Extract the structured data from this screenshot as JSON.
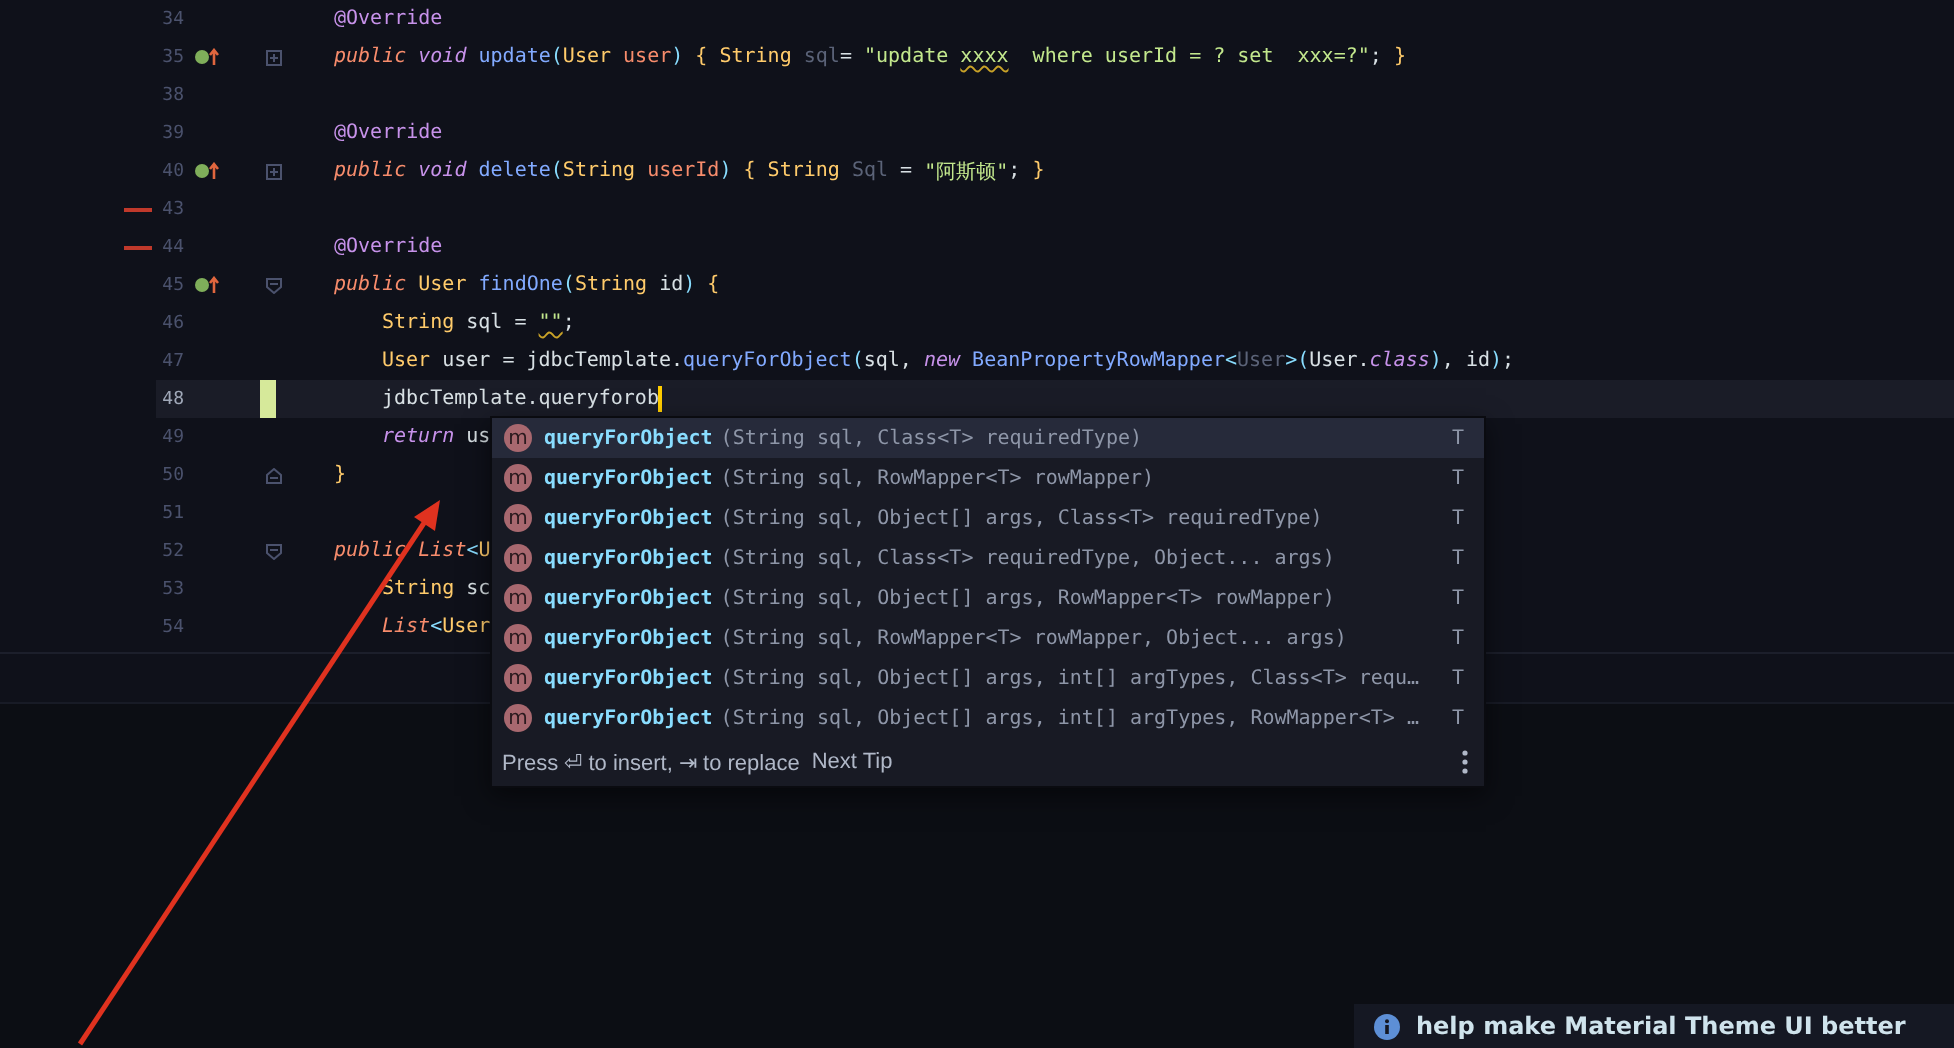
{
  "editor": {
    "lines": [
      {
        "number": "34",
        "kind": "member",
        "tokens": [
          {
            "kind": "ann",
            "text": "@Override"
          }
        ]
      },
      {
        "number": "35",
        "kind": "member",
        "override": true,
        "fold": {
          "kind": "collapsed"
        },
        "tokens": [
          {
            "kind": "mod",
            "text": "public"
          },
          {
            "kind": "kw",
            "text": " void"
          },
          {
            "kind": "fn",
            "text": " update"
          },
          {
            "kind": "punct",
            "text": "("
          },
          {
            "kind": "type",
            "text": "User"
          },
          {
            "kind": "param",
            "text": " user"
          },
          {
            "kind": "punct",
            "text": ")"
          },
          {
            "kind": "brace",
            "text": " {"
          },
          {
            "kind": "type",
            "text": " String"
          },
          {
            "kind": "dim",
            "text": " sql"
          },
          {
            "kind": "plain",
            "text": "= "
          },
          {
            "kind": "str",
            "text": "\"update "
          },
          {
            "kind": "warn",
            "text": "xxxx"
          },
          {
            "kind": "str",
            "text": "  where userId = ? set  xxx=?\""
          },
          {
            "kind": "plain",
            "text": ";"
          },
          {
            "kind": "brace",
            "text": " }"
          }
        ]
      },
      {
        "number": "38",
        "kind": "member"
      },
      {
        "number": "39",
        "kind": "member",
        "tokens": [
          {
            "kind": "ann",
            "text": "@Override"
          }
        ]
      },
      {
        "number": "40",
        "kind": "member",
        "override": true,
        "fold": {
          "kind": "collapsed"
        },
        "tokens": [
          {
            "kind": "mod",
            "text": "public"
          },
          {
            "kind": "kw",
            "text": " void"
          },
          {
            "kind": "fn",
            "text": " delete"
          },
          {
            "kind": "punct",
            "text": "("
          },
          {
            "kind": "type",
            "text": "String"
          },
          {
            "kind": "param",
            "text": " userId"
          },
          {
            "kind": "punct",
            "text": ")"
          },
          {
            "kind": "brace",
            "text": " {"
          },
          {
            "kind": "type",
            "text": " String"
          },
          {
            "kind": "dim",
            "text": " Sql"
          },
          {
            "kind": "plain",
            "text": " = "
          },
          {
            "kind": "str",
            "text": "\"阿斯顿\""
          },
          {
            "kind": "plain",
            "text": ";"
          },
          {
            "kind": "brace",
            "text": " }"
          }
        ]
      },
      {
        "number": "43",
        "kind": "member",
        "error": true
      },
      {
        "number": "44",
        "kind": "member",
        "error": true,
        "tokens": [
          {
            "kind": "ann",
            "text": "@Override"
          }
        ]
      },
      {
        "number": "45",
        "kind": "member",
        "override": true,
        "fold": {
          "kind": "open"
        },
        "tokens": [
          {
            "kind": "mod",
            "text": "public"
          },
          {
            "kind": "type",
            "text": " User"
          },
          {
            "kind": "fn",
            "text": " findOne"
          },
          {
            "kind": "punct",
            "text": "("
          },
          {
            "kind": "type",
            "text": "String"
          },
          {
            "kind": "plain",
            "text": " id"
          },
          {
            "kind": "punct",
            "text": ")"
          },
          {
            "kind": "brace",
            "text": " {"
          }
        ]
      },
      {
        "number": "46",
        "kind": "body",
        "tokens": [
          {
            "kind": "type",
            "text": "String"
          },
          {
            "kind": "plain",
            "text": " sql = "
          },
          {
            "kind": "warn",
            "text": "\"\""
          },
          {
            "kind": "plain",
            "text": ";"
          }
        ]
      },
      {
        "number": "47",
        "kind": "body",
        "tokens": [
          {
            "kind": "type",
            "text": "User"
          },
          {
            "kind": "plain",
            "text": " user = jdbcTemplate."
          },
          {
            "kind": "fn",
            "text": "queryForObject"
          },
          {
            "kind": "punct",
            "text": "("
          },
          {
            "kind": "plain",
            "text": "sql, "
          },
          {
            "kind": "kw",
            "text": "new"
          },
          {
            "kind": "fn",
            "text": " BeanPropertyRowMapper"
          },
          {
            "kind": "punct",
            "text": "<"
          },
          {
            "kind": "dim",
            "text": "User"
          },
          {
            "kind": "punct",
            "text": ">("
          },
          {
            "kind": "plain",
            "text": "User."
          },
          {
            "kind": "kw",
            "text": "class"
          },
          {
            "kind": "punct",
            "text": ")"
          },
          {
            "kind": "plain",
            "text": ", id"
          },
          {
            "kind": "punct",
            "text": ")"
          },
          {
            "kind": "plain",
            "text": ";"
          }
        ]
      },
      {
        "number": "48",
        "kind": "body",
        "changed": true,
        "current": true,
        "caret": true,
        "tokens": [
          {
            "kind": "plain",
            "text": "jdbcTemplate.queryforob"
          }
        ]
      },
      {
        "number": "49",
        "kind": "body",
        "tokens": [
          {
            "kind": "kw",
            "text": "return"
          },
          {
            "kind": "plain",
            "text": " us"
          }
        ]
      },
      {
        "number": "50",
        "kind": "member",
        "fold": {
          "kind": "end"
        },
        "tokens": [
          {
            "kind": "brace",
            "text": "}"
          }
        ]
      },
      {
        "number": "51",
        "kind": "member"
      },
      {
        "number": "52",
        "kind": "member",
        "fold": {
          "kind": "open"
        },
        "tokens": [
          {
            "kind": "mod",
            "text": "public"
          },
          {
            "kind": "mod",
            "text": " List"
          },
          {
            "kind": "punct",
            "text": "<"
          },
          {
            "kind": "type",
            "text": "U"
          }
        ]
      },
      {
        "number": "53",
        "kind": "body",
        "tokens": [
          {
            "kind": "type",
            "text": "String"
          },
          {
            "kind": "plain",
            "text": " sc"
          }
        ]
      },
      {
        "number": "54",
        "kind": "body",
        "tokens": [
          {
            "kind": "mod",
            "text": "List"
          },
          {
            "kind": "punct",
            "text": "<"
          },
          {
            "kind": "type",
            "text": "User"
          }
        ]
      }
    ]
  },
  "completion": {
    "items": [
      {
        "kind": "method",
        "icon_letter": "m",
        "name": "queryForObject",
        "signature": "(String sql, Class<T> requiredType)",
        "type": "T",
        "selected": true
      },
      {
        "kind": "method",
        "icon_letter": "m",
        "name": "queryForObject",
        "signature": "(String sql, RowMapper<T> rowMapper)",
        "type": "T",
        "selected": false
      },
      {
        "kind": "method",
        "icon_letter": "m",
        "name": "queryForObject",
        "signature": "(String sql, Object[] args, Class<T> requiredType)",
        "type": "T",
        "selected": false
      },
      {
        "kind": "method",
        "icon_letter": "m",
        "name": "queryForObject",
        "signature": "(String sql, Class<T> requiredType, Object... args)",
        "type": "T",
        "selected": false
      },
      {
        "kind": "method",
        "icon_letter": "m",
        "name": "queryForObject",
        "signature": "(String sql, Object[] args, RowMapper<T> rowMapper)",
        "type": "T",
        "selected": false
      },
      {
        "kind": "method",
        "icon_letter": "m",
        "name": "queryForObject",
        "signature": "(String sql, RowMapper<T> rowMapper, Object... args)",
        "type": "T",
        "selected": false
      },
      {
        "kind": "method",
        "icon_letter": "m",
        "name": "queryForObject",
        "signature": "(String sql, Object[] args, int[] argTypes, Class<T> requ…",
        "type": "T",
        "selected": false
      },
      {
        "kind": "method",
        "icon_letter": "m",
        "name": "queryForObject",
        "signature": "(String sql, Object[] args, int[] argTypes, RowMapper<T> …",
        "type": "T",
        "selected": false
      }
    ],
    "hint": "Press ⏎ to insert, ⇥ to replace",
    "next_tip": "Next Tip"
  },
  "notification": {
    "text": "help make Material Theme UI better"
  }
}
